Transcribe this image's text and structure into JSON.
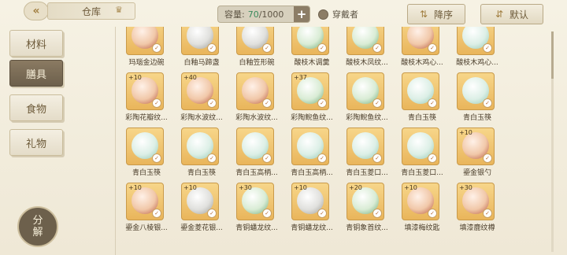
{
  "header": {
    "back_icon": "double-chevron-left-icon",
    "title": "仓库",
    "star_icon": "crown-icon",
    "capacity_label": "容量:",
    "capacity_current": "70",
    "capacity_max": "/1000",
    "plus_label": "+",
    "wear_filter_label": "穿戴者",
    "sort_label": "降序",
    "sort_icon": "sort-desc-icon",
    "default_label": "默认",
    "default_icon": "sort-swap-icon"
  },
  "sidebar": {
    "tabs": [
      {
        "label": "材料",
        "active": false
      },
      {
        "label": "膳具",
        "active": true
      },
      {
        "label": "食物",
        "active": false
      },
      {
        "label": "礼物",
        "active": false
      }
    ],
    "decompose_top": "分",
    "decompose_bottom": "解"
  },
  "items": [
    {
      "name": "玛瑙金边碗",
      "level": "",
      "tone": "red"
    },
    {
      "name": "白釉马蹄盏",
      "level": "",
      "tone": "grey"
    },
    {
      "name": "白釉笠形碗",
      "level": "",
      "tone": "grey"
    },
    {
      "name": "酸枝木调羹",
      "level": "",
      "tone": "green"
    },
    {
      "name": "酸枝木凤纹...",
      "level": "",
      "tone": "green"
    },
    {
      "name": "酸枝木鸡心...",
      "level": "",
      "tone": "red"
    },
    {
      "name": "酸枝木鸡心...",
      "level": "",
      "tone": "blue"
    },
    {
      "name": "彩陶花瓣纹...",
      "level": "+10",
      "tone": "red"
    },
    {
      "name": "彩陶水波纹...",
      "level": "+40",
      "tone": "red"
    },
    {
      "name": "彩陶水波纹...",
      "level": "",
      "tone": "red"
    },
    {
      "name": "彩陶鲵鱼纹...",
      "level": "+37",
      "tone": "green"
    },
    {
      "name": "彩陶鲵鱼纹...",
      "level": "",
      "tone": "green"
    },
    {
      "name": "青白玉筷",
      "level": "",
      "tone": "blue"
    },
    {
      "name": "青白玉筷",
      "level": "",
      "tone": "blue"
    },
    {
      "name": "青白玉筷",
      "level": "",
      "tone": "blue"
    },
    {
      "name": "青白玉筷",
      "level": "",
      "tone": "blue"
    },
    {
      "name": "青白玉高柄...",
      "level": "",
      "tone": "blue"
    },
    {
      "name": "青白玉高柄...",
      "level": "",
      "tone": "blue"
    },
    {
      "name": "青白玉菱口...",
      "level": "",
      "tone": "blue"
    },
    {
      "name": "青白玉菱口...",
      "level": "",
      "tone": "blue"
    },
    {
      "name": "鎏金银勺",
      "level": "+10",
      "tone": "red"
    },
    {
      "name": "鎏金八棱银...",
      "level": "+10",
      "tone": "red"
    },
    {
      "name": "鎏金菱花银...",
      "level": "+10",
      "tone": "grey"
    },
    {
      "name": "青铜蟠龙纹...",
      "level": "+30",
      "tone": "green"
    },
    {
      "name": "青铜蟠龙纹...",
      "level": "+10",
      "tone": "grey"
    },
    {
      "name": "青铜象首纹...",
      "level": "+20",
      "tone": "green"
    },
    {
      "name": "填漆梅纹匙",
      "level": "+10",
      "tone": "red"
    },
    {
      "name": "填漆鹿纹樽",
      "level": "+30",
      "tone": "red"
    }
  ]
}
